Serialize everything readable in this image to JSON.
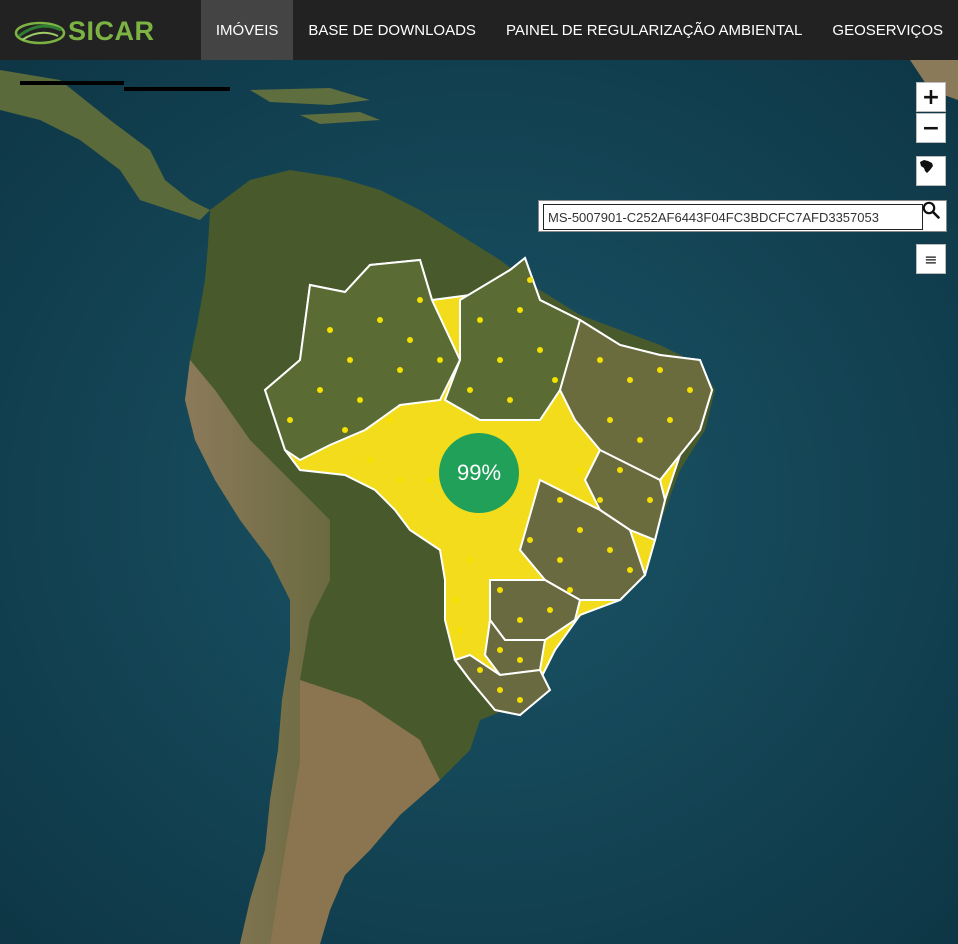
{
  "app": {
    "logo_text": "SICAR"
  },
  "nav": {
    "items": [
      {
        "label": "IMÓVEIS",
        "active": true
      },
      {
        "label": "BASE DE DOWNLOADS",
        "active": false
      },
      {
        "label": "PAINEL DE REGULARIZAÇÃO AMBIENTAL",
        "active": false
      },
      {
        "label": "GEOSERVIÇOS",
        "active": false
      }
    ]
  },
  "map": {
    "zoom_in_label": "+",
    "zoom_out_label": "−",
    "search": {
      "value": "MS-5007901-C252AF6443F04FC3BDCFC7AFD3357053",
      "placeholder": ""
    },
    "layers_label": "≡",
    "cluster_label": "99%",
    "icons": [
      "brazil-map-icon",
      "search-icon",
      "layers-icon",
      "zoom-in-icon",
      "zoom-out-icon"
    ],
    "colors": {
      "ocean": "#123f4f",
      "land": "#4a5a2e",
      "properties": "#f5e100",
      "cluster": "#21a05a",
      "navbar": "#222222",
      "active_nav": "#444444",
      "logo": "#7cb342"
    }
  }
}
